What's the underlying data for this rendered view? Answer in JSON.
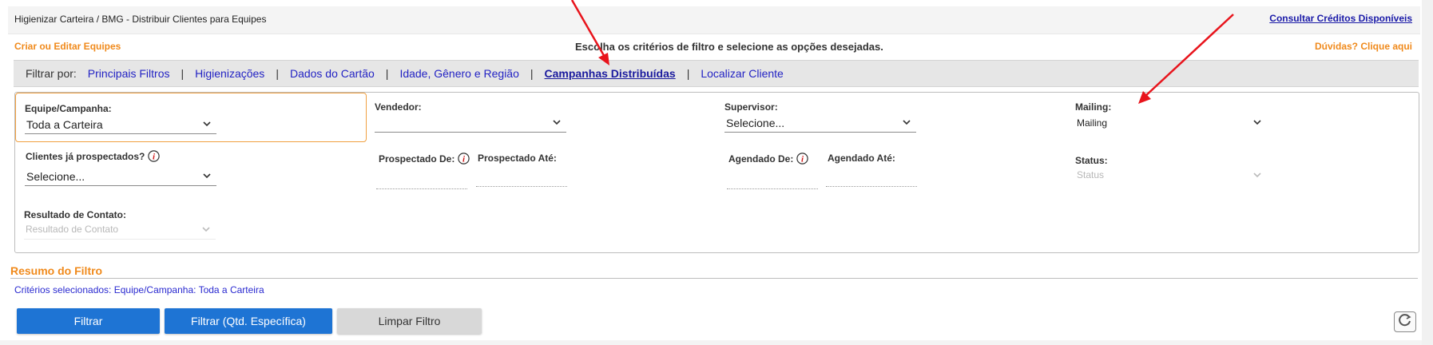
{
  "header": {
    "breadcrumb": "Higienizar Carteira / BMG - Distribuir Clientes para Equipes",
    "credits_link": "Consultar Créditos Disponíveis"
  },
  "links": {
    "teams": "Criar ou Editar Equipes",
    "help": "Dúvidas? Clique aqui"
  },
  "instruction": "Escolha os critérios de filtro e selecione as opções desejadas.",
  "filter_tabs": {
    "label": "Filtrar por:",
    "tabs": [
      {
        "label": "Principais Filtros"
      },
      {
        "label": "Higienizações"
      },
      {
        "label": "Dados do Cartão"
      },
      {
        "label": "Idade, Gênero e Região"
      },
      {
        "label": "Campanhas Distribuídas",
        "active": true
      },
      {
        "label": "Localizar Cliente"
      }
    ]
  },
  "fields": {
    "equipe": {
      "label": "Equipe/Campanha:",
      "value": "Toda a Carteira"
    },
    "vendedor": {
      "label": "Vendedor:",
      "value": ""
    },
    "supervisor": {
      "label": "Supervisor:",
      "value": "Selecione..."
    },
    "mailing": {
      "label": "Mailing:",
      "value": "Mailing"
    },
    "prospectados": {
      "label": "Clientes já prospectados?",
      "value": "Selecione..."
    },
    "prospectado_de": {
      "label": "Prospectado De:"
    },
    "prospectado_ate": {
      "label": "Prospectado Até:"
    },
    "agendado_de": {
      "label": "Agendado De:"
    },
    "agendado_ate": {
      "label": "Agendado Até:"
    },
    "status": {
      "label": "Status:",
      "value": "Status"
    },
    "resultado": {
      "label": "Resultado de Contato:",
      "value": "Resultado de Contato"
    }
  },
  "summary": {
    "title": "Resumo do Filtro",
    "criteria": "Critérios selecionados: Equipe/Campanha: Toda a Carteira"
  },
  "buttons": {
    "filter": "Filtrar",
    "filter_qty": "Filtrar (Qtd. Específica)",
    "clear": "Limpar Filtro"
  },
  "colors": {
    "accent_orange": "#f08a1c",
    "primary_blue": "#1e74d4",
    "link_blue": "#2323c4",
    "arrow_red": "#e8141c"
  }
}
